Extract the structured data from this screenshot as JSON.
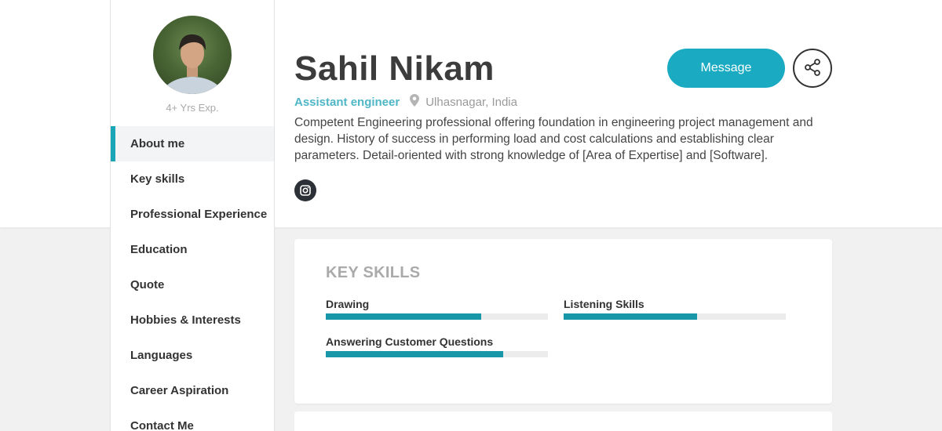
{
  "profile": {
    "experience": "4+ Yrs Exp.",
    "name": "Sahil Nikam",
    "role": "Assistant engineer",
    "location": "Ulhasnagar, India",
    "bio": "Competent Engineering professional offering foundation in engineering project management and design. History of success in performing load and cost calculations and establishing clear parameters. Detail-oriented with strong knowledge of [Area of Expertise] and [Software].",
    "social": [
      {
        "icon": "instagram-icon"
      }
    ]
  },
  "actions": {
    "message_label": "Message",
    "share_icon": "share-icon"
  },
  "nav": {
    "items": [
      {
        "label": "About me",
        "active": true
      },
      {
        "label": "Key skills"
      },
      {
        "label": "Professional Experience"
      },
      {
        "label": "Education"
      },
      {
        "label": "Quote"
      },
      {
        "label": "Hobbies & Interests"
      },
      {
        "label": "Languages"
      },
      {
        "label": "Career Aspiration"
      },
      {
        "label": "Contact Me"
      }
    ]
  },
  "key_skills": {
    "title": "KEY SKILLS",
    "skills": [
      {
        "label": "Drawing",
        "level": 0.7
      },
      {
        "label": "Listening Skills",
        "level": 0.6
      },
      {
        "label": "Answering Customer Questions",
        "level": 0.8
      }
    ]
  },
  "colors": {
    "accent": "#1aabc3",
    "role": "#4eb6c6",
    "bar": "#1797a8"
  }
}
